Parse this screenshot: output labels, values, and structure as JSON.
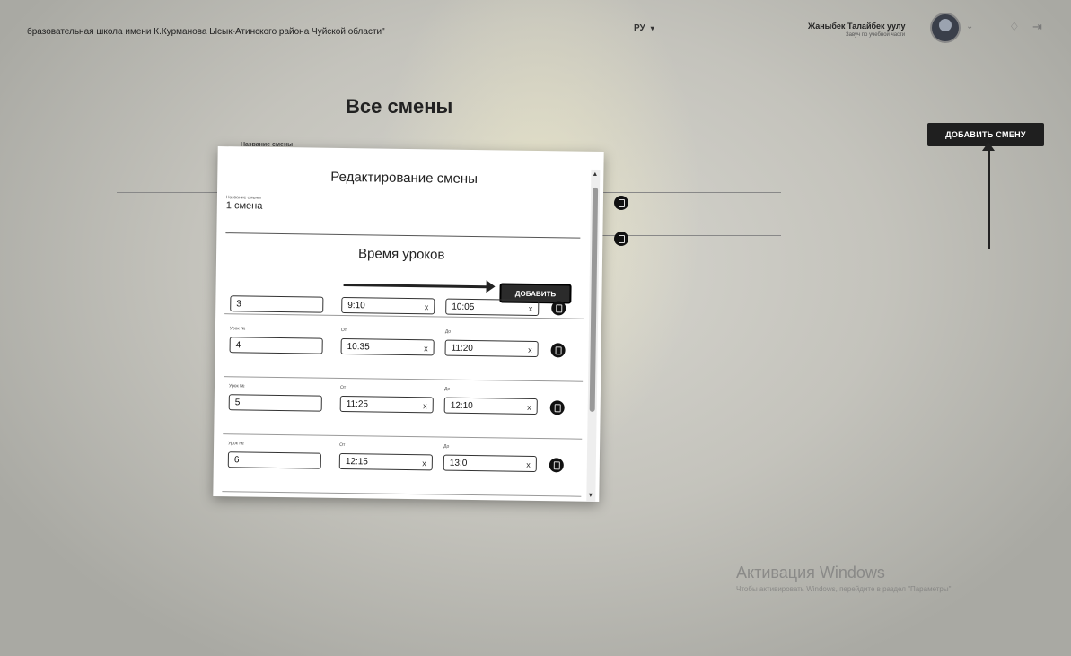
{
  "header": {
    "school_name": "бразовательная школа имени К.Курманова Ысык-Атинского района Чуйской области\"",
    "language": "РУ",
    "user_name": "Жаныбек Талайбек уулу",
    "user_role": "Завуч по учебной части"
  },
  "page": {
    "title": "Все смены",
    "add_shift_label": "ДОБАВИТЬ СМЕНУ",
    "list_column_label": "Название смены"
  },
  "modal": {
    "title": "Редактирование смены",
    "name_label": "Название смены",
    "name_value": "1 смена",
    "lessons_title": "Время уроков",
    "add_label": "ДОБАВИТЬ",
    "lesson_label": "Урок №",
    "from_label": "От",
    "to_label": "До",
    "clear_symbol": "x",
    "lessons": [
      {
        "number": "3",
        "from": "9:10",
        "to": "10:05"
      },
      {
        "number": "4",
        "from": "10:35",
        "to": "11:20"
      },
      {
        "number": "5",
        "from": "11:25",
        "to": "12:10"
      },
      {
        "number": "6",
        "from": "12:15",
        "to": "13:0"
      }
    ]
  },
  "watermark": {
    "title": "Активация Windows",
    "subtitle": "Чтобы активировать Windows, перейдите в раздел \"Параметры\"."
  },
  "icons": {
    "avatar": "user-avatar-icon",
    "chevron": "chevron-down-icon",
    "bell": "bell-icon",
    "logout": "logout-icon",
    "delete": "trash-icon"
  }
}
